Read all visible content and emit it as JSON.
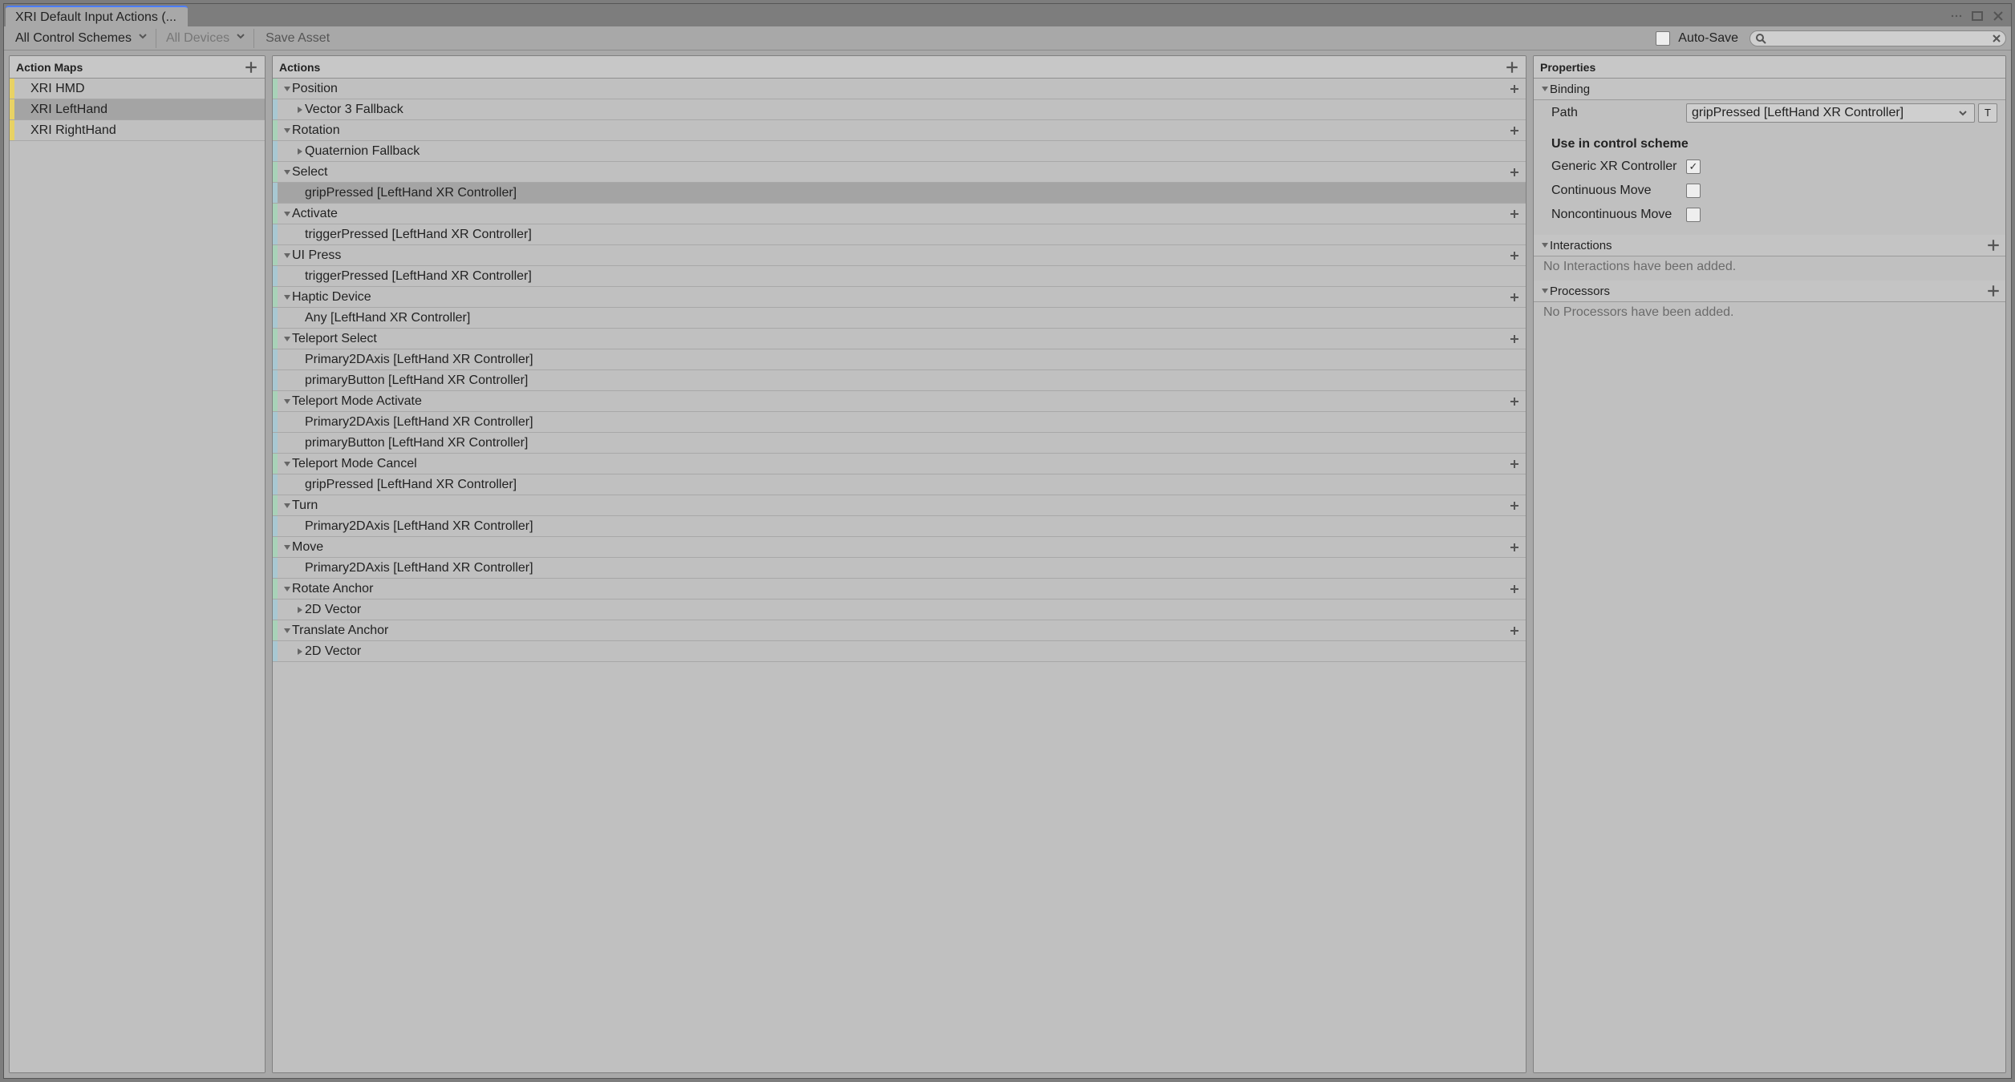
{
  "tab": {
    "title": "XRI Default Input Actions (..."
  },
  "toolbar": {
    "schemes": "All Control Schemes",
    "devices": "All Devices",
    "save": "Save Asset",
    "autosave": "Auto-Save",
    "search_placeholder": ""
  },
  "panels": {
    "maps_title": "Action Maps",
    "actions_title": "Actions",
    "props_title": "Properties"
  },
  "action_maps": [
    {
      "name": "XRI HMD",
      "selected": false
    },
    {
      "name": "XRI LeftHand",
      "selected": true
    },
    {
      "name": "XRI RightHand",
      "selected": false
    }
  ],
  "actions": [
    {
      "level": 1,
      "stripe": "g",
      "fold": "down",
      "label": "Position",
      "add": true
    },
    {
      "level": 2,
      "stripe": "b",
      "fold": "right",
      "label": "Vector 3 Fallback",
      "add": false
    },
    {
      "level": 1,
      "stripe": "g",
      "fold": "down",
      "label": "Rotation",
      "add": true
    },
    {
      "level": 2,
      "stripe": "b",
      "fold": "right",
      "label": "Quaternion Fallback",
      "add": false
    },
    {
      "level": 1,
      "stripe": "g",
      "fold": "down",
      "label": "Select",
      "add": true
    },
    {
      "level": 2,
      "stripe": "b",
      "fold": "",
      "label": "gripPressed [LeftHand XR Controller]",
      "add": false,
      "selected": true
    },
    {
      "level": 1,
      "stripe": "g",
      "fold": "down",
      "label": "Activate",
      "add": true
    },
    {
      "level": 2,
      "stripe": "b",
      "fold": "",
      "label": "triggerPressed [LeftHand XR Controller]",
      "add": false
    },
    {
      "level": 1,
      "stripe": "g",
      "fold": "down",
      "label": "UI Press",
      "add": true
    },
    {
      "level": 2,
      "stripe": "b",
      "fold": "",
      "label": "triggerPressed [LeftHand XR Controller]",
      "add": false
    },
    {
      "level": 1,
      "stripe": "g",
      "fold": "down",
      "label": "Haptic Device",
      "add": true
    },
    {
      "level": 2,
      "stripe": "b",
      "fold": "",
      "label": "Any [LeftHand XR Controller]",
      "add": false
    },
    {
      "level": 1,
      "stripe": "g",
      "fold": "down",
      "label": "Teleport Select",
      "add": true
    },
    {
      "level": 2,
      "stripe": "b",
      "fold": "",
      "label": "Primary2DAxis [LeftHand XR Controller]",
      "add": false
    },
    {
      "level": 2,
      "stripe": "b",
      "fold": "",
      "label": "primaryButton [LeftHand XR Controller]",
      "add": false
    },
    {
      "level": 1,
      "stripe": "g",
      "fold": "down",
      "label": "Teleport Mode Activate",
      "add": true
    },
    {
      "level": 2,
      "stripe": "b",
      "fold": "",
      "label": "Primary2DAxis [LeftHand XR Controller]",
      "add": false
    },
    {
      "level": 2,
      "stripe": "b",
      "fold": "",
      "label": "primaryButton [LeftHand XR Controller]",
      "add": false
    },
    {
      "level": 1,
      "stripe": "g",
      "fold": "down",
      "label": "Teleport Mode Cancel",
      "add": true
    },
    {
      "level": 2,
      "stripe": "b",
      "fold": "",
      "label": "gripPressed [LeftHand XR Controller]",
      "add": false
    },
    {
      "level": 1,
      "stripe": "g",
      "fold": "down",
      "label": "Turn",
      "add": true
    },
    {
      "level": 2,
      "stripe": "b",
      "fold": "",
      "label": "Primary2DAxis [LeftHand XR Controller]",
      "add": false
    },
    {
      "level": 1,
      "stripe": "g",
      "fold": "down",
      "label": "Move",
      "add": true
    },
    {
      "level": 2,
      "stripe": "b",
      "fold": "",
      "label": "Primary2DAxis [LeftHand XR Controller]",
      "add": false
    },
    {
      "level": 1,
      "stripe": "g",
      "fold": "down",
      "label": "Rotate Anchor",
      "add": true
    },
    {
      "level": 2,
      "stripe": "b",
      "fold": "right",
      "label": "2D Vector",
      "add": false
    },
    {
      "level": 1,
      "stripe": "g",
      "fold": "down",
      "label": "Translate Anchor",
      "add": true
    },
    {
      "level": 2,
      "stripe": "b",
      "fold": "right",
      "label": "2D Vector",
      "add": false
    }
  ],
  "properties": {
    "binding_hdr": "Binding",
    "path_label": "Path",
    "path_value": "gripPressed [LeftHand XR Controller]",
    "t_button": "T",
    "scheme_hdr": "Use in control scheme",
    "schemes": [
      {
        "name": "Generic XR Controller",
        "checked": true
      },
      {
        "name": "Continuous Move",
        "checked": false
      },
      {
        "name": "Noncontinuous Move",
        "checked": false
      }
    ],
    "interactions_hdr": "Interactions",
    "interactions_empty": "No Interactions have been added.",
    "processors_hdr": "Processors",
    "processors_empty": "No Processors have been added."
  }
}
